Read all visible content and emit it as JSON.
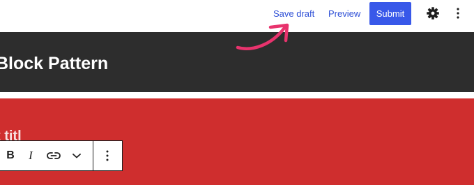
{
  "header": {
    "save_draft_label": "Save draft",
    "preview_label": "Preview",
    "submit_label": "Submit",
    "settings_icon": "gear-icon",
    "options_icon": "vertical-ellipsis-icon"
  },
  "content": {
    "banner_title": "Block Pattern",
    "red_block_text": "t titl"
  },
  "block_toolbar": {
    "bold_label": "B",
    "italic_label": "I",
    "link_icon": "link-icon",
    "more_icon": "chevron-down-icon",
    "options_icon": "vertical-ellipsis-icon"
  },
  "annotation": {
    "arrow_icon": "curved-arrow-icon",
    "arrow_color": "#e8336d"
  },
  "colors": {
    "accent": "#3858e9",
    "link": "#2f50d6",
    "dark_banner": "#2d2d2d",
    "red_block": "#cf2e2e"
  }
}
